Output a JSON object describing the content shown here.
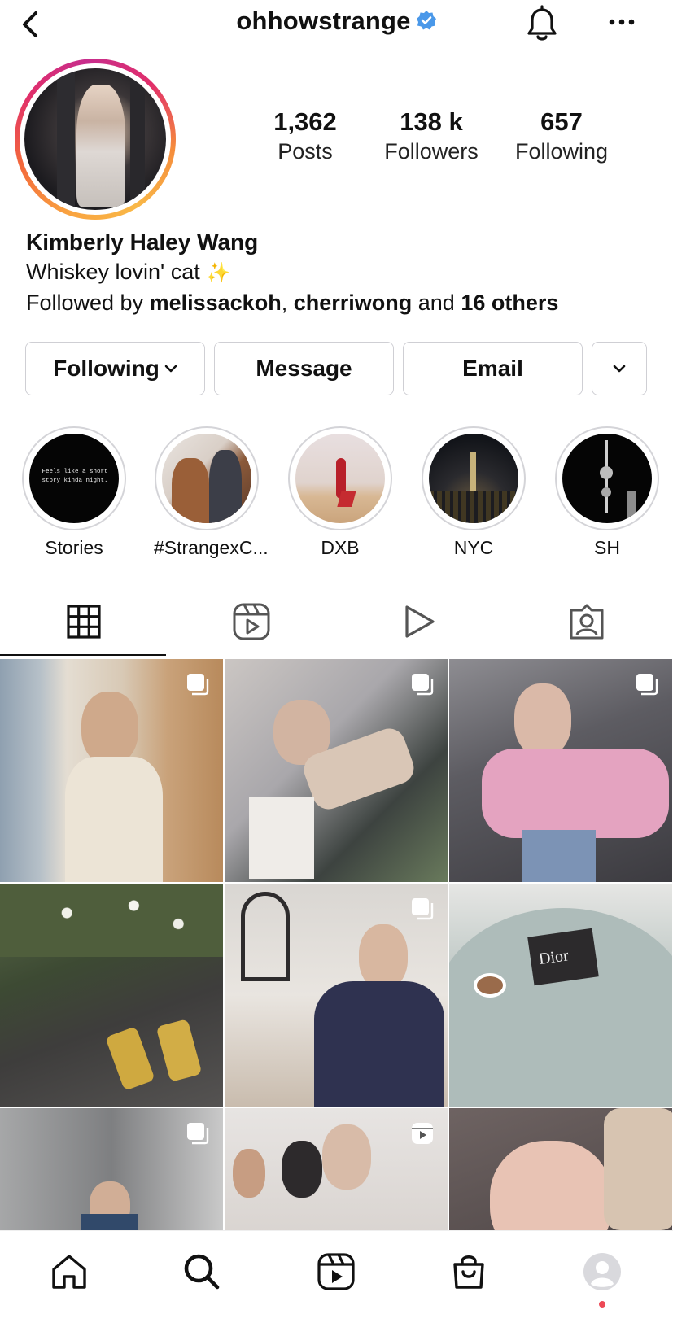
{
  "header": {
    "username": "ohhowstrange",
    "verified": true
  },
  "profile": {
    "stats": [
      {
        "value": "1,362",
        "label": "Posts"
      },
      {
        "value": "138 k",
        "label": "Followers"
      },
      {
        "value": "657",
        "label": "Following"
      }
    ],
    "name": "Kimberly Haley Wang",
    "bio": "Whiskey lovin' cat",
    "bio_emoji": "✨",
    "followed_by": {
      "prefix": "Followed by",
      "users": [
        "melissackoh",
        "cherriwong"
      ],
      "separator": ",",
      "conjunction": "and",
      "others": "16 others"
    }
  },
  "actions": {
    "following": "Following",
    "message": "Message",
    "email": "Email"
  },
  "highlights": [
    {
      "label": "Stories",
      "cover_text": "Feels like a short story kinda night."
    },
    {
      "label": "#StrangexC..."
    },
    {
      "label": "DXB"
    },
    {
      "label": "NYC"
    },
    {
      "label": "SH"
    }
  ],
  "tabs": [
    "grid-icon",
    "reels-icon",
    "play-icon",
    "tagged-icon"
  ],
  "posts": [
    {
      "type": "carousel"
    },
    {
      "type": "carousel"
    },
    {
      "type": "carousel"
    },
    {
      "type": "photo"
    },
    {
      "type": "carousel"
    },
    {
      "type": "photo",
      "cover_text": "Dior"
    },
    {
      "type": "carousel"
    },
    {
      "type": "reel"
    },
    {
      "type": "photo"
    }
  ],
  "bottom_nav": [
    "home-icon",
    "search-icon",
    "reels-icon",
    "shop-icon",
    "profile-avatar"
  ],
  "colors": {
    "verified": "#4a98e9",
    "notification_dot": "#ed4956",
    "border": "#cfcfd4"
  }
}
